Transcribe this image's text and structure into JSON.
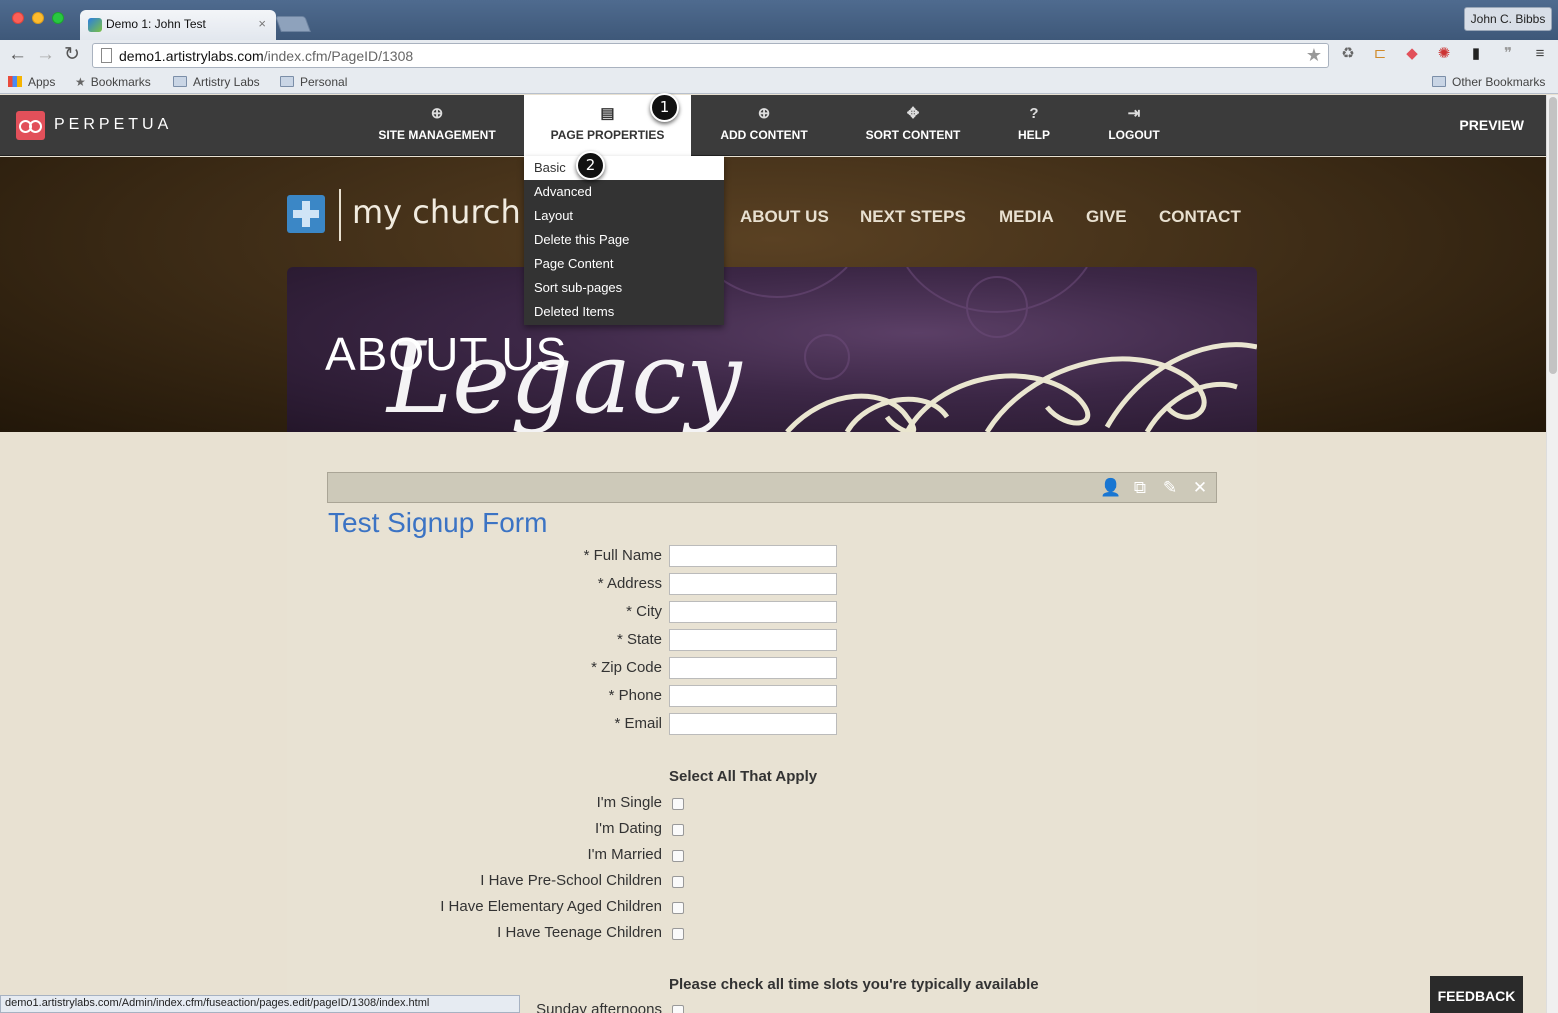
{
  "browser": {
    "tab_title": "Demo 1: John Test",
    "tab_close": "×",
    "profile_name": "John C. Bibbs",
    "url_host": "demo1.artistrylabs.com",
    "url_path": "/index.cfm/PageID/1308",
    "bookmarks": [
      "Apps",
      "Bookmarks",
      "Artistry Labs",
      "Personal"
    ],
    "other_bookmarks": "Other Bookmarks",
    "status_url": "demo1.artistrylabs.com/Admin/index.cfm/fuseaction/pages.edit/pageID/1308/index.html"
  },
  "admin": {
    "brand": "PERPETUA",
    "items": [
      {
        "label": "SITE MANAGEMENT",
        "icon": "globe-icon"
      },
      {
        "label": "PAGE PROPERTIES",
        "icon": "document-icon"
      },
      {
        "label": "ADD CONTENT",
        "icon": "plus-circle-icon"
      },
      {
        "label": "SORT CONTENT",
        "icon": "move-icon"
      },
      {
        "label": "HELP",
        "icon": "question-icon"
      },
      {
        "label": "LOGOUT",
        "icon": "logout-icon"
      }
    ],
    "preview": "PREVIEW",
    "dropdown": [
      "Basic",
      "Advanced",
      "Layout",
      "Delete this Page",
      "Page Content",
      "Sort sub-pages",
      "Deleted Items"
    ],
    "callouts": [
      "1",
      "2"
    ]
  },
  "site": {
    "logo_text": "my church",
    "nav": [
      "ABOUT US",
      "NEXT STEPS",
      "MEDIA",
      "GIVE",
      "CONTACT"
    ],
    "banner_title": "ABOUT US",
    "banner_script": "Legacy"
  },
  "form": {
    "title": "Test Signup Form",
    "fields": [
      "* Full Name",
      "* Address",
      "* City",
      "* State",
      "* Zip Code",
      "* Phone",
      "* Email"
    ],
    "select_heading": "Select All That Apply",
    "checkboxes": [
      "I'm Single",
      "I'm Dating",
      "I'm Married",
      "I Have Pre-School Children",
      "I Have Elementary Aged Children",
      "I Have Teenage Children"
    ],
    "timeslot_heading": "Please check all time slots you're typically available",
    "timeslots": [
      "Sunday afternoons"
    ]
  },
  "feedback": "FEEDBACK"
}
